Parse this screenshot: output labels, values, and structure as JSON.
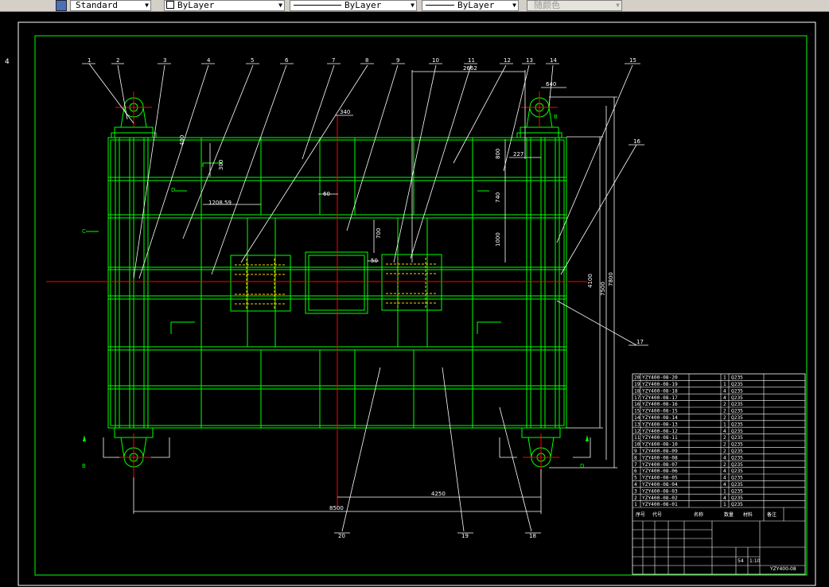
{
  "toolbar": {
    "text_style": "Standard",
    "layer_color": "ByLayer",
    "linetype": "ByLayer",
    "lineweight": "ByLayer",
    "plot_style": "随颜色"
  },
  "margin_mark": "4",
  "balloons_top": [
    "1",
    "2",
    "3",
    "4",
    "5",
    "6",
    "7",
    "8",
    "9",
    "10",
    "11",
    "12",
    "13",
    "14",
    "15",
    "16"
  ],
  "balloons_bottom": [
    "20",
    "19",
    "18"
  ],
  "balloon_right": "17",
  "dimensions": {
    "top_span": "2662",
    "top_small": "340",
    "right_top": "640",
    "right_227": "227",
    "right_800": "800",
    "right_740": "740",
    "right_1000": "1000",
    "left_1208": "1208.59",
    "dim_60": "60",
    "dim_50": "50",
    "dim_700": "700",
    "left_400": "400",
    "left_300": "300",
    "height_4100": "4100",
    "height_7500": "7500",
    "height_7800": "7800",
    "bottom_4250": "4250",
    "bottom_8500": "8500"
  },
  "section_labels": {
    "c_left": "C",
    "d_left": "D",
    "d_right": "D",
    "b_left": "B",
    "b_right": "B"
  },
  "parts_table": {
    "rows": [
      {
        "no": "20",
        "code": "YZY400-08-20",
        "qty": "1",
        "mat": "Q235"
      },
      {
        "no": "19",
        "code": "YZY400-08-19",
        "qty": "1",
        "mat": "Q235"
      },
      {
        "no": "18",
        "code": "YZY400-08-18",
        "qty": "4",
        "mat": "Q235"
      },
      {
        "no": "17",
        "code": "YZY400-08-17",
        "qty": "4",
        "mat": "Q235"
      },
      {
        "no": "16",
        "code": "YZY400-08-16",
        "qty": "2",
        "mat": "Q235"
      },
      {
        "no": "15",
        "code": "YZY400-08-15",
        "qty": "2",
        "mat": "Q235"
      },
      {
        "no": "14",
        "code": "YZY400-08-14",
        "qty": "2",
        "mat": "Q235"
      },
      {
        "no": "13",
        "code": "YZY400-08-13",
        "qty": "1",
        "mat": "Q235"
      },
      {
        "no": "12",
        "code": "YZY400-08-12",
        "qty": "4",
        "mat": "Q235"
      },
      {
        "no": "11",
        "code": "YZY400-08-11",
        "qty": "2",
        "mat": "Q235"
      },
      {
        "no": "10",
        "code": "YZY400-08-10",
        "qty": "2",
        "mat": "Q235"
      },
      {
        "no": "9",
        "code": "YZY400-08-09",
        "qty": "2",
        "mat": "Q235"
      },
      {
        "no": "8",
        "code": "YZY400-08-08",
        "qty": "4",
        "mat": "Q235"
      },
      {
        "no": "7",
        "code": "YZY400-08-07",
        "qty": "2",
        "mat": "Q235"
      },
      {
        "no": "6",
        "code": "YZY400-08-06",
        "qty": "4",
        "mat": "Q235"
      },
      {
        "no": "5",
        "code": "YZY400-08-05",
        "qty": "4",
        "mat": "Q235"
      },
      {
        "no": "4",
        "code": "YZY400-08-04",
        "qty": "4",
        "mat": "Q235"
      },
      {
        "no": "3",
        "code": "YZY400-08-03",
        "qty": "1",
        "mat": "Q235"
      },
      {
        "no": "2",
        "code": "YZY400-08-02",
        "qty": "4",
        "mat": "Q235"
      },
      {
        "no": "1",
        "code": "YZY400-08-01",
        "qty": "1",
        "mat": "Q235"
      }
    ],
    "header": {
      "no": "序号",
      "code": "代号",
      "name": "名称",
      "qty": "数量",
      "mat": "材料",
      "note": "备注"
    },
    "scale": "1:10",
    "sheet": "54",
    "drawing_no": "YZY400-08"
  },
  "colors": {
    "frame": "#00ff00",
    "axis": "#ff0000",
    "text": "#ffffff",
    "hidden": "#ffcc00"
  }
}
